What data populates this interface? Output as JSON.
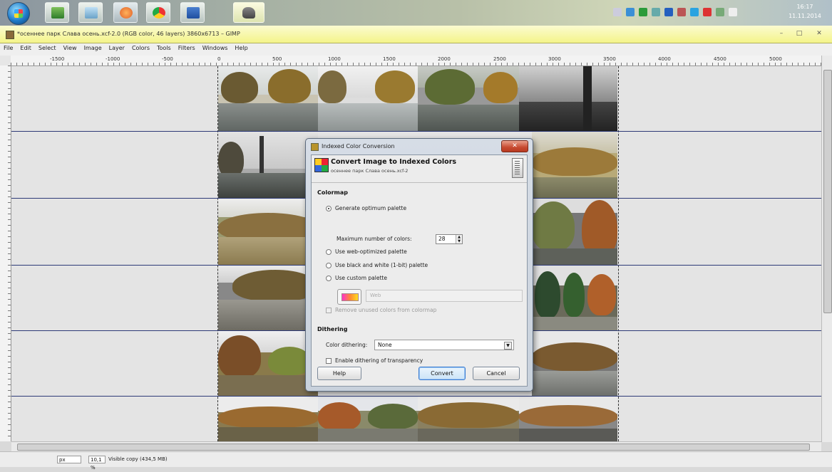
{
  "taskbar": {
    "clock_time": "16:17",
    "clock_date": "11.11.2014"
  },
  "window": {
    "title": "*осеннее парк Слава осень.xcf-2.0 (RGB color, 46 layers) 3860x6713 – GIMP",
    "min": "–",
    "max": "□",
    "close": "✕"
  },
  "menu": [
    "File",
    "Edit",
    "Select",
    "View",
    "Image",
    "Layer",
    "Colors",
    "Tools",
    "Filters",
    "Windows",
    "Help"
  ],
  "ruler_ticks": [
    "-1500",
    "-1000",
    "-500",
    "0",
    "500",
    "1000",
    "1500",
    "2000",
    "2500",
    "3000",
    "3500",
    "4000",
    "4500",
    "5000"
  ],
  "status": {
    "unit": "px",
    "zoom": "10,1 %",
    "info": "Visible copy (434,5 MB)"
  },
  "dialog": {
    "window_title": "Indexed Color Conversion",
    "close": "✕",
    "header_title": "Convert Image to Indexed Colors",
    "header_subtitle": "осеннее парк Слава осень.xcf-2",
    "colormap_label": "Colormap",
    "opt_generate": "Generate optimum palette",
    "max_colors_label": "Maximum number of colors:",
    "max_colors_value": "28",
    "opt_web": "Use web-optimized palette",
    "opt_bw": "Use black and white (1-bit) palette",
    "opt_custom": "Use custom palette",
    "custom_palette_name": "Web",
    "remove_unused": "Remove unused colors from colormap",
    "dithering_label": "Dithering",
    "color_dithering_label": "Color dithering:",
    "color_dithering_value": "None",
    "enable_dither_transparency": "Enable dithering of transparency",
    "help": "Help",
    "convert": "Convert",
    "cancel": "Cancel"
  },
  "colors": {
    "title_bar": "#f4f48a",
    "dialog_close": "#c64a30",
    "guide": "#2d3a77"
  }
}
